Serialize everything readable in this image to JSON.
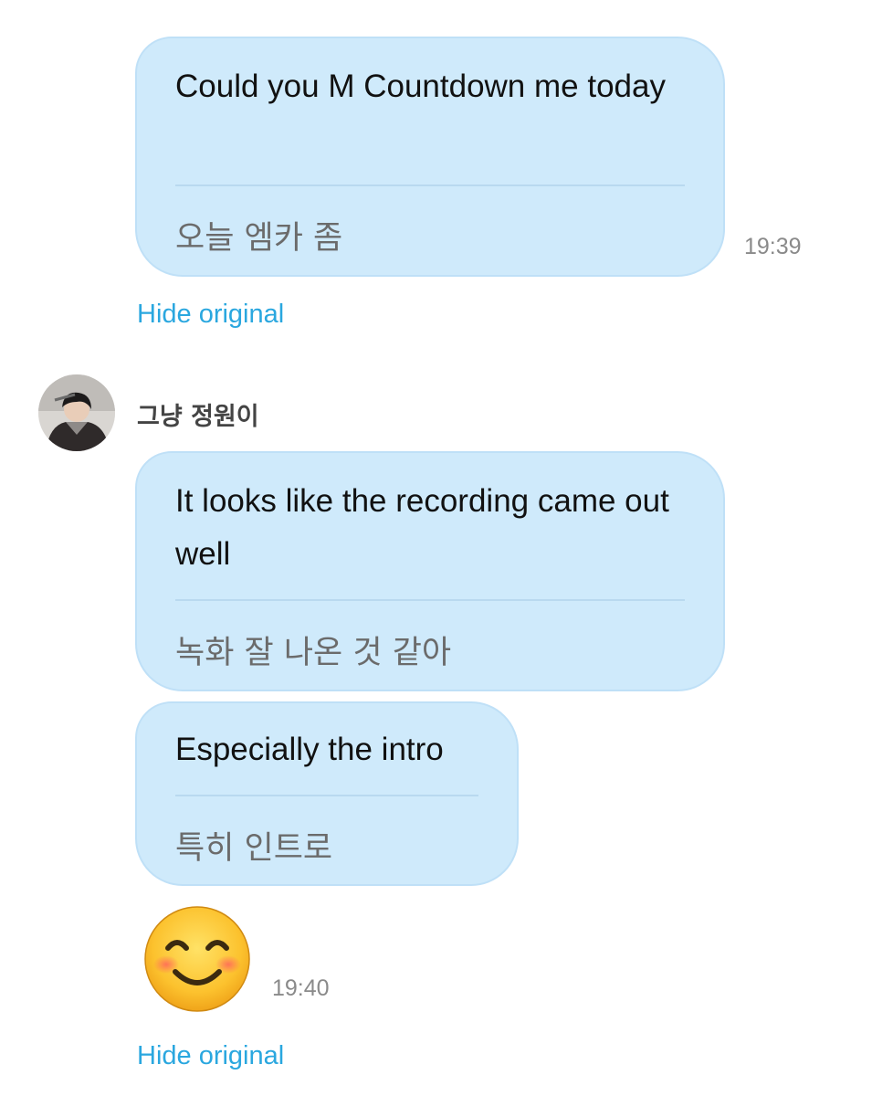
{
  "messages": [
    {
      "translation": "Could you M Countdown me today",
      "original": "오늘 엠카 좀",
      "time": "19:39",
      "hide_label": "Hide original"
    },
    {
      "sender": "그냥 정원이",
      "bubbles": [
        {
          "translation": "It looks like the recording came out well",
          "original": "녹화 잘 나온 것 같아"
        },
        {
          "translation": "Especially the intro",
          "original": "특히 인트로"
        }
      ],
      "emoji": "smiling-face-with-smiling-eyes",
      "time": "19:40",
      "hide_label": "Hide original"
    }
  ],
  "colors": {
    "bubble_bg": "#cfeafb",
    "link": "#2aa7df",
    "timestamp": "#8a8a8a"
  }
}
